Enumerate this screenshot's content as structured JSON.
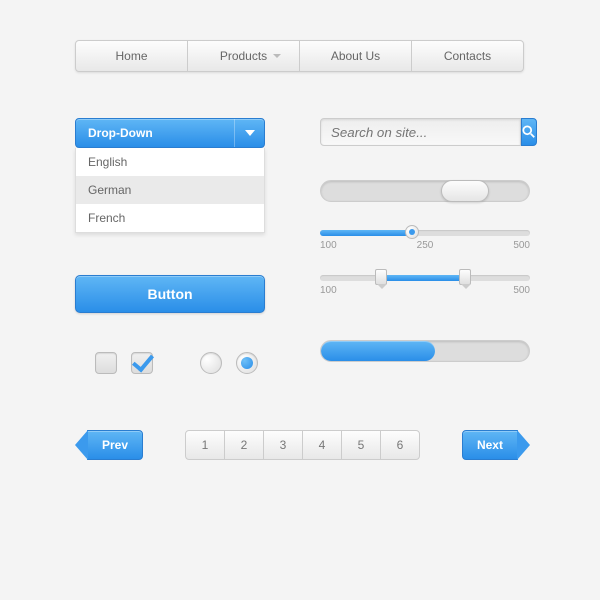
{
  "nav": {
    "items": [
      "Home",
      "Products",
      "About Us",
      "Contacts"
    ]
  },
  "dropdown": {
    "label": "Drop-Down",
    "options": [
      "English",
      "German",
      "French"
    ],
    "selected_index": 1
  },
  "search": {
    "placeholder": "Search on site..."
  },
  "toggle": {
    "on": false
  },
  "slider_single": {
    "min": 100,
    "mid": 250,
    "max": 500,
    "value": 260
  },
  "slider_range": {
    "min": 100,
    "max": 500,
    "from": 210,
    "to": 370
  },
  "button": {
    "label": "Button"
  },
  "progress": {
    "percent": 55
  },
  "checkbox": {
    "unchecked": false,
    "checked": true
  },
  "radio": {
    "unchecked": false,
    "checked": true
  },
  "pagination": {
    "prev_label": "Prev",
    "next_label": "Next",
    "pages": [
      "1",
      "2",
      "3",
      "4",
      "5",
      "6"
    ]
  },
  "colors": {
    "accent": "#3b9aed",
    "accent_dark": "#2a8ee8"
  }
}
